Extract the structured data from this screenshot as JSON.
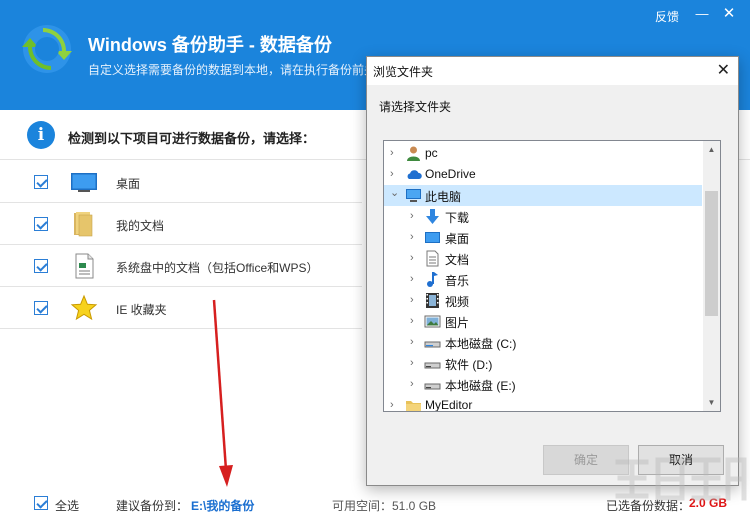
{
  "app": {
    "title": "Windows 备份助手 - 数据备份",
    "subtitle": "自定义选择需要备份的数据到本地，请在执行备份前关",
    "feedback": "反馈",
    "minimize": "—",
    "close": "✕",
    "prompt": "检测到以下项目可进行数据备份，请选择：",
    "info": "i"
  },
  "items": [
    {
      "label": "桌面",
      "icon": "desktop-icon",
      "checked": true
    },
    {
      "label": "我的文档",
      "icon": "folder-icon",
      "checked": true
    },
    {
      "label": "系统盘中的文档（包括Office和WPS）",
      "icon": "document-icon",
      "checked": true
    },
    {
      "label": "IE 收藏夹",
      "icon": "star-icon",
      "checked": true
    }
  ],
  "footer": {
    "select_all": "全选",
    "suggest_label": "建议备份到：",
    "suggest_path": "E:\\我的备份",
    "free_space": "可用空间：51.0 GB",
    "selected_label": "已选备份数据：",
    "selected_size": "2.0 GB"
  },
  "dialog": {
    "title": "浏览文件夹",
    "close": "✕",
    "prompt": "请选择文件夹",
    "ok": "确定",
    "cancel": "取消",
    "tree": [
      {
        "label": "pc",
        "icon": "user-icon",
        "level": 0,
        "expander": "›"
      },
      {
        "label": "OneDrive",
        "icon": "cloud-icon",
        "level": 0,
        "expander": "›"
      },
      {
        "label": "此电脑",
        "icon": "computer-icon",
        "level": 0,
        "expander": "⌄",
        "selected": true
      },
      {
        "label": "下载",
        "icon": "download-icon",
        "level": 1,
        "expander": "›"
      },
      {
        "label": "桌面",
        "icon": "desktop-icon",
        "level": 1,
        "expander": "›"
      },
      {
        "label": "文档",
        "icon": "document-icon",
        "level": 1,
        "expander": "›"
      },
      {
        "label": "音乐",
        "icon": "music-icon",
        "level": 1,
        "expander": "›"
      },
      {
        "label": "视频",
        "icon": "video-icon",
        "level": 1,
        "expander": "›"
      },
      {
        "label": "图片",
        "icon": "picture-icon",
        "level": 1,
        "expander": "›"
      },
      {
        "label": "本地磁盘 (C:)",
        "icon": "drive-icon",
        "level": 1,
        "expander": "›"
      },
      {
        "label": "软件 (D:)",
        "icon": "drive-icon",
        "level": 1,
        "expander": "›"
      },
      {
        "label": "本地磁盘 (E:)",
        "icon": "drive-icon",
        "level": 1,
        "expander": "›"
      },
      {
        "label": "MyEditor",
        "icon": "folder-icon",
        "level": 0,
        "expander": "›"
      }
    ]
  },
  "colors": {
    "header": "#1b84dc",
    "accent": "#2b7ed6",
    "path_link": "#1b6fd0",
    "size_highlight": "#e01515",
    "annotation_arrow": "#d61f1f",
    "tree_selection": "#cce8ff"
  }
}
